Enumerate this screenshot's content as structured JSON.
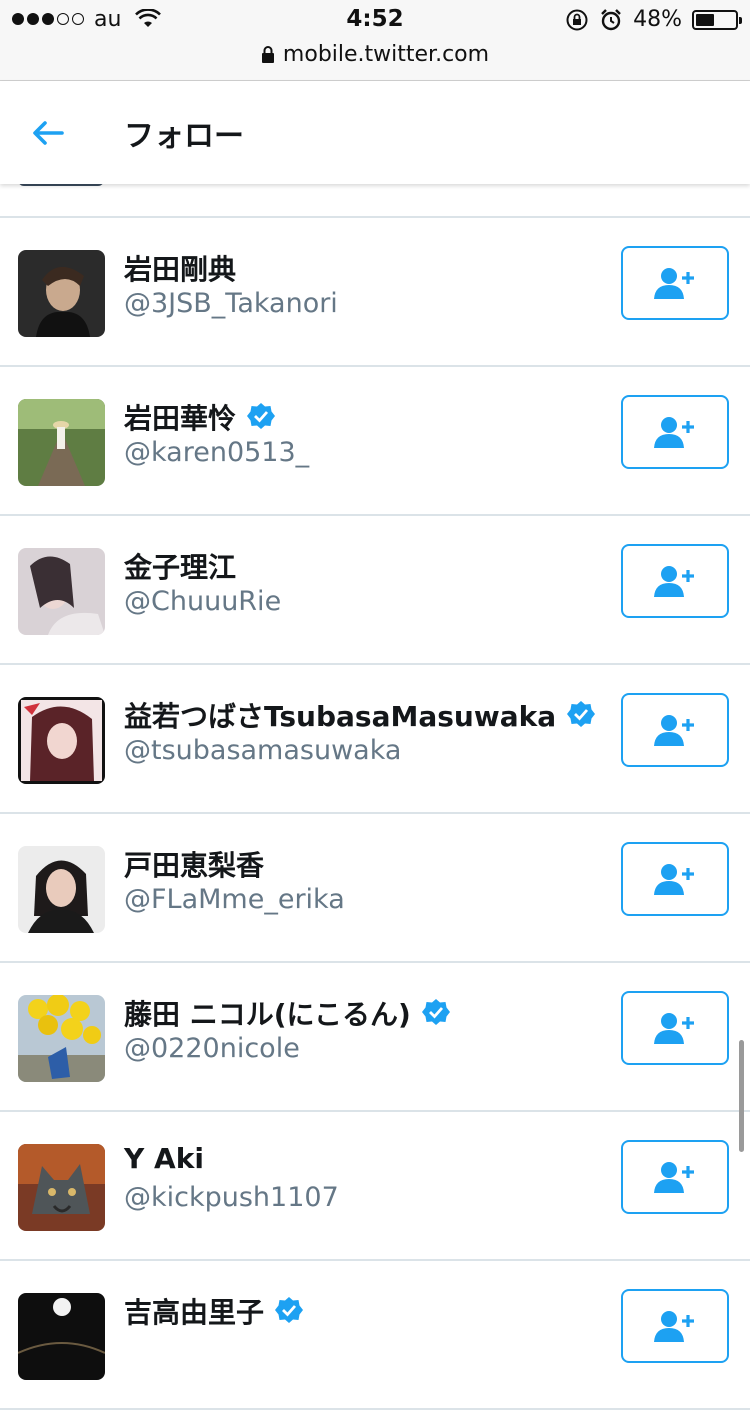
{
  "status_bar": {
    "carrier": "au",
    "time": "4:52",
    "battery_percent": "48%",
    "battery_level": 0.48,
    "url": "mobile.twitter.com"
  },
  "header": {
    "title": "フォロー"
  },
  "colors": {
    "accent": "#1da1f2",
    "secondary_text": "#657786",
    "divider": "#dbe3e8"
  },
  "users": [
    {
      "name": "岩田剛典",
      "handle": "@3JSB_Takanori",
      "verified": false
    },
    {
      "name": "岩田華怜",
      "handle": "@karen0513_",
      "verified": true
    },
    {
      "name": "金子理江",
      "handle": "@ChuuuRie",
      "verified": false
    },
    {
      "name": "益若つばさTsubasaMasuwaka",
      "handle": "@tsubasamasuwaka",
      "verified": true
    },
    {
      "name": "戸田恵梨香",
      "handle": "@FLaMme_erika",
      "verified": false
    },
    {
      "name": "藤田 ニコル(にこるん)",
      "handle": "@0220nicole",
      "verified": true
    },
    {
      "name": "Y Aki",
      "handle": "@kickpush1107",
      "verified": false
    },
    {
      "name": "吉高由里子",
      "handle": "",
      "verified": true
    }
  ]
}
